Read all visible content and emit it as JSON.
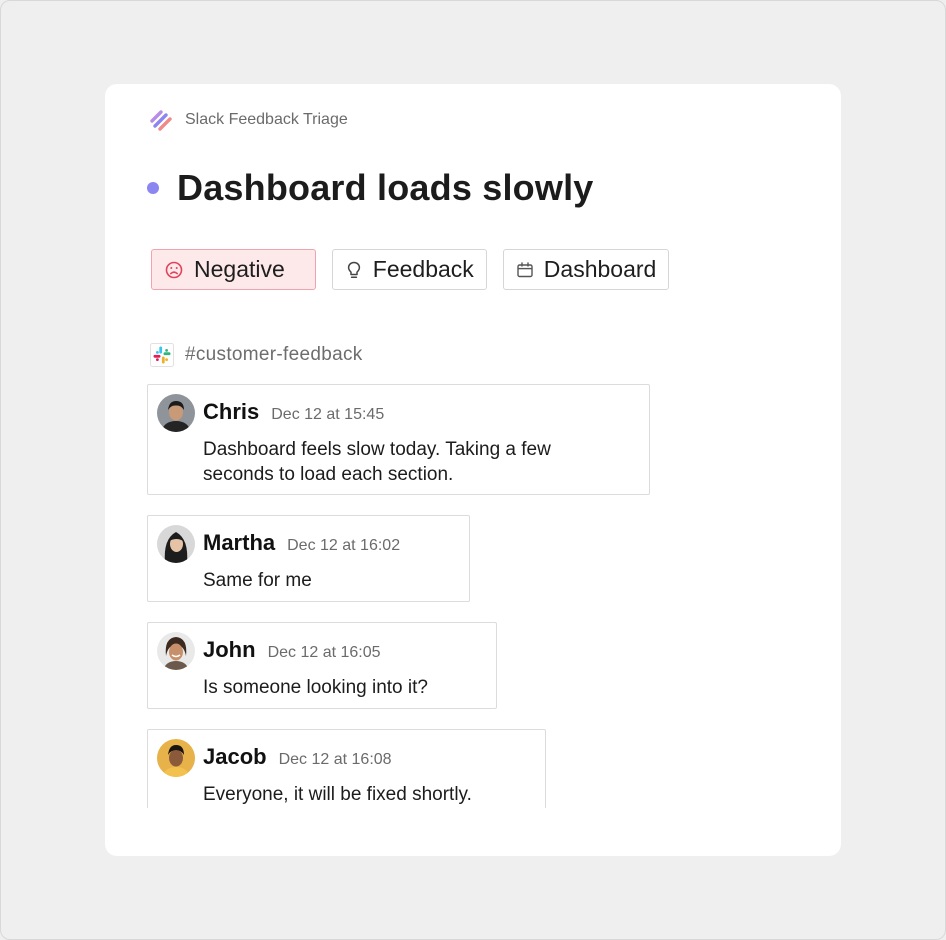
{
  "app": {
    "name": "Slack Feedback Triage"
  },
  "issue": {
    "title": "Dashboard loads slowly",
    "status_color": "#8b86f0"
  },
  "tags": [
    {
      "label": "Negative",
      "icon": "frown-icon",
      "color": "#e0435c"
    },
    {
      "label": "Feedback",
      "icon": "lightbulb-icon"
    },
    {
      "label": "Dashboard",
      "icon": "calendar-icon"
    }
  ],
  "channel": {
    "name": "#customer-feedback",
    "icon": "slack-logo-icon"
  },
  "messages": [
    {
      "author": "Chris",
      "time": "Dec 12 at 15:45",
      "text_line1": "Dashboard feels slow today. Taking a few",
      "text_line2": "seconds to load each section."
    },
    {
      "author": "Martha",
      "time": "Dec 12 at 16:02",
      "text_line1": "Same for me"
    },
    {
      "author": "John",
      "time": "Dec 12 at 16:05",
      "text_line1": "Is someone looking into it?"
    },
    {
      "author": "Jacob",
      "time": "Dec 12 at 16:08",
      "text_line1": "Everyone, it will be fixed shortly."
    }
  ]
}
